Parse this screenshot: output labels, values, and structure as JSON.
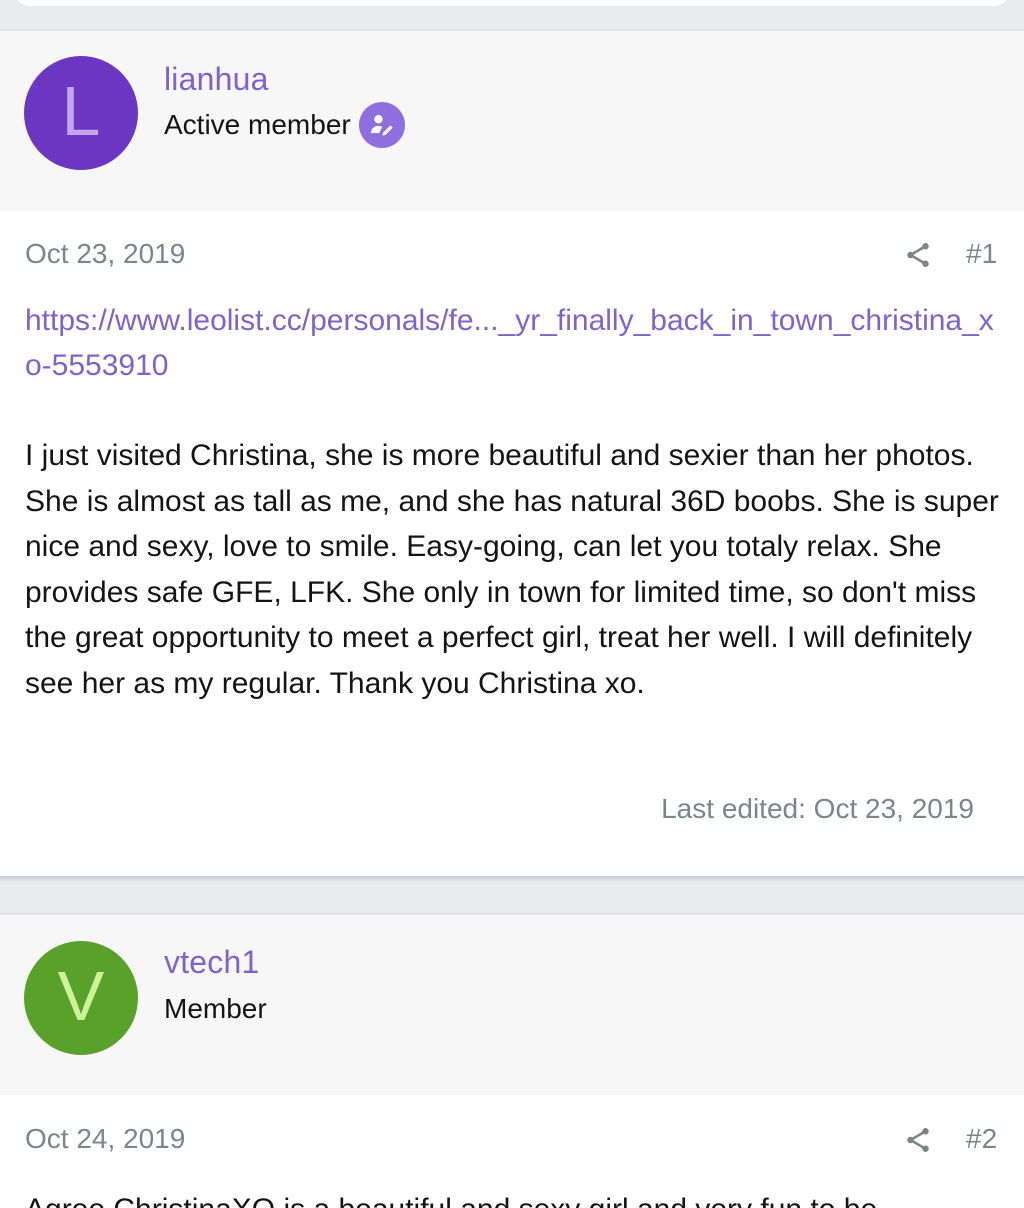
{
  "posts": [
    {
      "username": "lianhua",
      "user_title": "Active member",
      "avatar_letter": "L",
      "avatar_color": "#6a36c2",
      "avatar_letter_color": "#c2a6f0",
      "date": "Oct 23, 2019",
      "post_number": "#1",
      "link": "https://www.leolist.cc/personals/fe..._yr_finally_back_in_town_christina_xo-5553910",
      "body": "I just visited Christina, she is more beautiful and sexier than her photos. She is almost as tall as me, and she has natural 36D boobs. She is super nice and sexy, love to smile. Easy-going, can let you totaly relax. She provides safe GFE, LFK. She only in town for limited time, so don't miss the great opportunity to meet a perfect girl, treat her well. I will definitely see her as my regular. Thank you Christina xo.",
      "last_edited": "Last edited: Oct 23, 2019"
    },
    {
      "username": "vtech1",
      "user_title": "Member",
      "avatar_letter": "V",
      "avatar_color": "#58a22a",
      "avatar_letter_color": "#cdf29a",
      "date": "Oct 24, 2019",
      "post_number": "#2",
      "body_partial": "Agree ChristinaXO is a beautiful and sexy girl and very fun to be"
    }
  ],
  "icons": {
    "share": "share-icon",
    "badge": "user-edit-icon"
  },
  "colors": {
    "accent": "#7b64d0",
    "badge": "#8f6fe0",
    "meta_text": "#7c858a"
  }
}
